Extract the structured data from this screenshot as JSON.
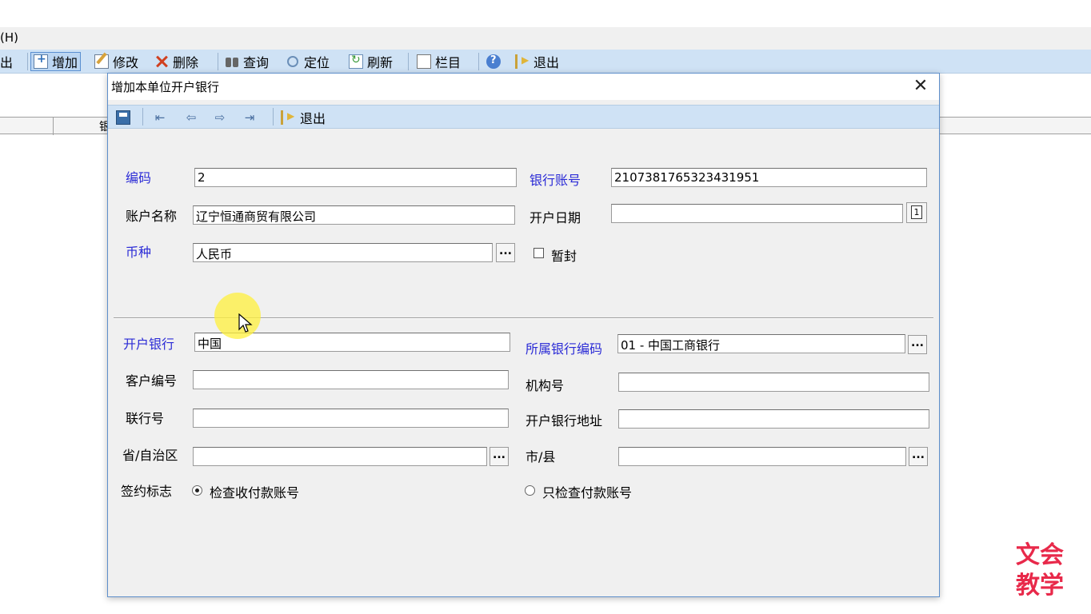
{
  "menubar": {
    "partial_item": "(H)"
  },
  "main_toolbar": {
    "partial_left": "出",
    "items": [
      {
        "label": "增加",
        "icon": "add-doc-icon"
      },
      {
        "label": "修改",
        "icon": "edit-icon"
      },
      {
        "label": "删除",
        "icon": "delete-x-icon"
      },
      {
        "label": "查询",
        "icon": "binoculars-icon"
      },
      {
        "label": "定位",
        "icon": "locate-icon"
      },
      {
        "label": "刷新",
        "icon": "refresh-icon"
      },
      {
        "label": "栏目",
        "icon": "columns-icon"
      },
      {
        "label": "",
        "icon": "help-icon"
      },
      {
        "label": "退出",
        "icon": "exit-icon"
      }
    ]
  },
  "background_grid": {
    "partial_header": "银"
  },
  "dialog": {
    "title": "增加本单位开户银行",
    "close": "✕",
    "toolbar": {
      "exit_label": "退出"
    },
    "fields": {
      "code": {
        "label": "编码",
        "value": "2"
      },
      "bank_account": {
        "label": "银行账号",
        "value": "2107381765323431951"
      },
      "account_name": {
        "label": "账户名称",
        "value": "辽宁恒通商贸有限公司"
      },
      "open_date": {
        "label": "开户日期",
        "value": ""
      },
      "currency": {
        "label": "币种",
        "value": "人民币"
      },
      "frozen": {
        "label": "暂封",
        "checked": false
      },
      "open_bank": {
        "label": "开户银行",
        "value": "中国"
      },
      "bank_code": {
        "label": "所属银行编码",
        "value": "01 - 中国工商银行"
      },
      "customer_no": {
        "label": "客户编号",
        "value": ""
      },
      "org_no": {
        "label": "机构号",
        "value": ""
      },
      "union_no": {
        "label": "联行号",
        "value": ""
      },
      "bank_address": {
        "label": "开户银行地址",
        "value": ""
      },
      "province": {
        "label": "省/自治区",
        "value": ""
      },
      "city": {
        "label": "市/县",
        "value": ""
      },
      "sign_flag": {
        "label": "签约标志"
      },
      "option_check_receive": {
        "label": "检查收付款账号",
        "selected": true
      },
      "option_check_pay": {
        "label": "只检查付款账号",
        "selected": false
      }
    },
    "ellipsis": "...",
    "calendar_glyph": "1"
  },
  "watermark": {
    "line1": "文会",
    "line2": "教学"
  },
  "colors": {
    "toolbar_bg": "#cfe2f5",
    "required_label": "#2b2bd6",
    "watermark": "#e8294a"
  }
}
